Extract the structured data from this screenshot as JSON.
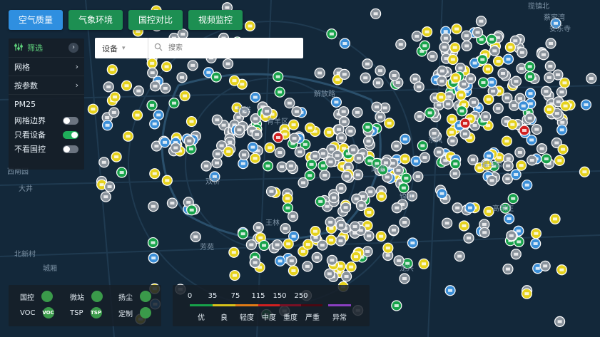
{
  "nav": {
    "tabs": [
      {
        "label": "空气质量",
        "active": true
      },
      {
        "label": "气象环境",
        "active": false
      },
      {
        "label": "国控对比",
        "active": false
      },
      {
        "label": "视频监控",
        "active": false
      }
    ]
  },
  "filter": {
    "title": "筛选",
    "rows": [
      {
        "label": "网格"
      },
      {
        "label": "按参数"
      }
    ],
    "param": "PM25",
    "toggles": [
      {
        "label": "网格边界",
        "on": false
      },
      {
        "label": "只看设备",
        "on": true
      },
      {
        "label": "不看国控",
        "on": false
      }
    ]
  },
  "search": {
    "type_value": "设备",
    "placeholder": "搜索"
  },
  "legend_types": [
    {
      "label": "国控",
      "badge": "",
      "color": "#3a9a4a",
      "icon": "gov-station-icon"
    },
    {
      "label": "微站",
      "badge": "",
      "color": "#3a9a4a",
      "icon": "micro-station-icon"
    },
    {
      "label": "扬尘",
      "badge": "",
      "color": "#3a9a4a",
      "icon": "dust-icon"
    },
    {
      "label": "VOC",
      "badge": "VOC",
      "color": "#3a9a4a",
      "icon": "voc-icon"
    },
    {
      "label": "TSP",
      "badge": "TSP",
      "color": "#3a9a4a",
      "icon": "tsp-icon"
    },
    {
      "label": "定制",
      "badge": "",
      "color": "#3a9a4a",
      "icon": "custom-icon"
    }
  ],
  "aqi_scale": {
    "thresholds": [
      "0",
      "35",
      "75",
      "115",
      "150",
      "250"
    ],
    "levels": [
      {
        "label": "优",
        "color": "#17a24a"
      },
      {
        "label": "良",
        "color": "#d8c21a"
      },
      {
        "label": "轻度",
        "color": "#e07a16"
      },
      {
        "label": "中度",
        "color": "#d02020"
      },
      {
        "label": "重度",
        "color": "#7a1024"
      },
      {
        "label": "严重",
        "color": "#4a0812"
      },
      {
        "label": "异常",
        "color": "#8a3fc0"
      }
    ]
  },
  "map_labels": [
    "揽镇北",
    "蔡家湾",
    "安乐寺",
    "解放路",
    "扶塔",
    "青羊区",
    "双桥",
    "王林",
    "大井",
    "西南园",
    "福华园",
    "高家庄",
    "北新村",
    "锦江",
    "东风",
    "武侯",
    "芳苑",
    "龙兴",
    "城厢"
  ],
  "colors": {
    "good": "#17a24a",
    "moderate": "#e6d21c",
    "gray": "#8a939c",
    "blue": "#3b8fd8",
    "red": "#d02020"
  }
}
